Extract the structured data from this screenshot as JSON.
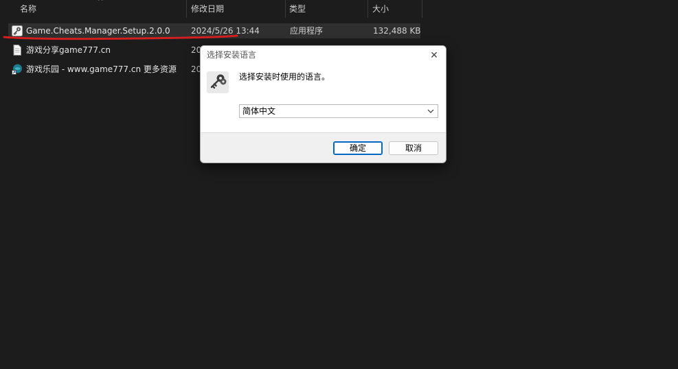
{
  "columns": {
    "name": "名称",
    "modified": "修改日期",
    "type": "类型",
    "size": "大小"
  },
  "files": [
    {
      "name": "Game.Cheats.Manager.Setup.2.0.0",
      "modified": "2024/5/26 13:44",
      "type": "应用程序",
      "size": "132,488 KB",
      "icon": "setup-key-icon",
      "selected": true
    },
    {
      "name": "游戏分享game777.cn",
      "modified": "20",
      "icon": "text-file-icon"
    },
    {
      "name": "游戏乐园 - www.game777.cn 更多资源",
      "modified": "20",
      "icon": "web-shortcut-icon"
    }
  ],
  "dialog": {
    "title": "选择安装语言",
    "message": "选择安装时使用的语言。",
    "language": "简体中文",
    "ok_label": "确定",
    "cancel_label": "取消",
    "icon": "keys-icon"
  },
  "annotation": {
    "color": "#d21f1f"
  }
}
